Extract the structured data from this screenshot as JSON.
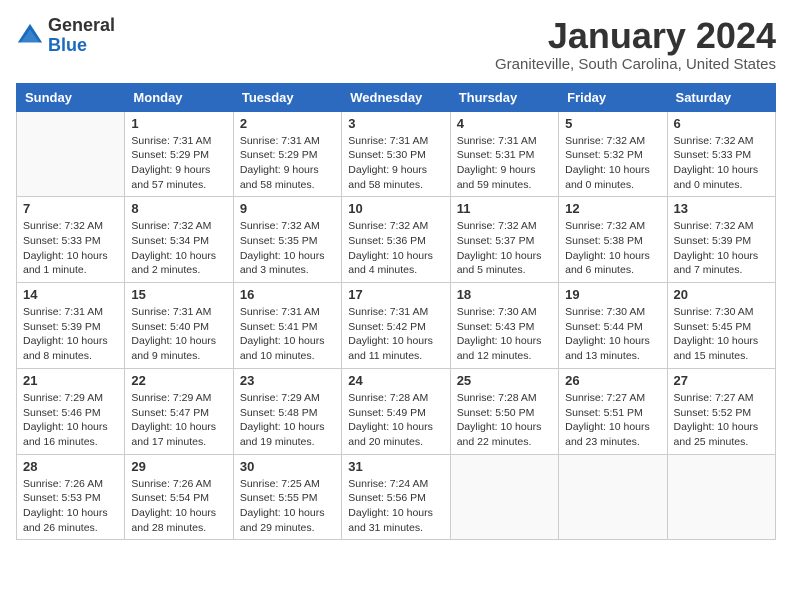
{
  "logo": {
    "general": "General",
    "blue": "Blue"
  },
  "title": "January 2024",
  "location": "Graniteville, South Carolina, United States",
  "days_of_week": [
    "Sunday",
    "Monday",
    "Tuesday",
    "Wednesday",
    "Thursday",
    "Friday",
    "Saturday"
  ],
  "weeks": [
    [
      {
        "day": "",
        "info": ""
      },
      {
        "day": "1",
        "info": "Sunrise: 7:31 AM\nSunset: 5:29 PM\nDaylight: 9 hours\nand 57 minutes."
      },
      {
        "day": "2",
        "info": "Sunrise: 7:31 AM\nSunset: 5:29 PM\nDaylight: 9 hours\nand 58 minutes."
      },
      {
        "day": "3",
        "info": "Sunrise: 7:31 AM\nSunset: 5:30 PM\nDaylight: 9 hours\nand 58 minutes."
      },
      {
        "day": "4",
        "info": "Sunrise: 7:31 AM\nSunset: 5:31 PM\nDaylight: 9 hours\nand 59 minutes."
      },
      {
        "day": "5",
        "info": "Sunrise: 7:32 AM\nSunset: 5:32 PM\nDaylight: 10 hours\nand 0 minutes."
      },
      {
        "day": "6",
        "info": "Sunrise: 7:32 AM\nSunset: 5:33 PM\nDaylight: 10 hours\nand 0 minutes."
      }
    ],
    [
      {
        "day": "7",
        "info": "Sunrise: 7:32 AM\nSunset: 5:33 PM\nDaylight: 10 hours\nand 1 minute."
      },
      {
        "day": "8",
        "info": "Sunrise: 7:32 AM\nSunset: 5:34 PM\nDaylight: 10 hours\nand 2 minutes."
      },
      {
        "day": "9",
        "info": "Sunrise: 7:32 AM\nSunset: 5:35 PM\nDaylight: 10 hours\nand 3 minutes."
      },
      {
        "day": "10",
        "info": "Sunrise: 7:32 AM\nSunset: 5:36 PM\nDaylight: 10 hours\nand 4 minutes."
      },
      {
        "day": "11",
        "info": "Sunrise: 7:32 AM\nSunset: 5:37 PM\nDaylight: 10 hours\nand 5 minutes."
      },
      {
        "day": "12",
        "info": "Sunrise: 7:32 AM\nSunset: 5:38 PM\nDaylight: 10 hours\nand 6 minutes."
      },
      {
        "day": "13",
        "info": "Sunrise: 7:32 AM\nSunset: 5:39 PM\nDaylight: 10 hours\nand 7 minutes."
      }
    ],
    [
      {
        "day": "14",
        "info": "Sunrise: 7:31 AM\nSunset: 5:39 PM\nDaylight: 10 hours\nand 8 minutes."
      },
      {
        "day": "15",
        "info": "Sunrise: 7:31 AM\nSunset: 5:40 PM\nDaylight: 10 hours\nand 9 minutes."
      },
      {
        "day": "16",
        "info": "Sunrise: 7:31 AM\nSunset: 5:41 PM\nDaylight: 10 hours\nand 10 minutes."
      },
      {
        "day": "17",
        "info": "Sunrise: 7:31 AM\nSunset: 5:42 PM\nDaylight: 10 hours\nand 11 minutes."
      },
      {
        "day": "18",
        "info": "Sunrise: 7:30 AM\nSunset: 5:43 PM\nDaylight: 10 hours\nand 12 minutes."
      },
      {
        "day": "19",
        "info": "Sunrise: 7:30 AM\nSunset: 5:44 PM\nDaylight: 10 hours\nand 13 minutes."
      },
      {
        "day": "20",
        "info": "Sunrise: 7:30 AM\nSunset: 5:45 PM\nDaylight: 10 hours\nand 15 minutes."
      }
    ],
    [
      {
        "day": "21",
        "info": "Sunrise: 7:29 AM\nSunset: 5:46 PM\nDaylight: 10 hours\nand 16 minutes."
      },
      {
        "day": "22",
        "info": "Sunrise: 7:29 AM\nSunset: 5:47 PM\nDaylight: 10 hours\nand 17 minutes."
      },
      {
        "day": "23",
        "info": "Sunrise: 7:29 AM\nSunset: 5:48 PM\nDaylight: 10 hours\nand 19 minutes."
      },
      {
        "day": "24",
        "info": "Sunrise: 7:28 AM\nSunset: 5:49 PM\nDaylight: 10 hours\nand 20 minutes."
      },
      {
        "day": "25",
        "info": "Sunrise: 7:28 AM\nSunset: 5:50 PM\nDaylight: 10 hours\nand 22 minutes."
      },
      {
        "day": "26",
        "info": "Sunrise: 7:27 AM\nSunset: 5:51 PM\nDaylight: 10 hours\nand 23 minutes."
      },
      {
        "day": "27",
        "info": "Sunrise: 7:27 AM\nSunset: 5:52 PM\nDaylight: 10 hours\nand 25 minutes."
      }
    ],
    [
      {
        "day": "28",
        "info": "Sunrise: 7:26 AM\nSunset: 5:53 PM\nDaylight: 10 hours\nand 26 minutes."
      },
      {
        "day": "29",
        "info": "Sunrise: 7:26 AM\nSunset: 5:54 PM\nDaylight: 10 hours\nand 28 minutes."
      },
      {
        "day": "30",
        "info": "Sunrise: 7:25 AM\nSunset: 5:55 PM\nDaylight: 10 hours\nand 29 minutes."
      },
      {
        "day": "31",
        "info": "Sunrise: 7:24 AM\nSunset: 5:56 PM\nDaylight: 10 hours\nand 31 minutes."
      },
      {
        "day": "",
        "info": ""
      },
      {
        "day": "",
        "info": ""
      },
      {
        "day": "",
        "info": ""
      }
    ]
  ]
}
